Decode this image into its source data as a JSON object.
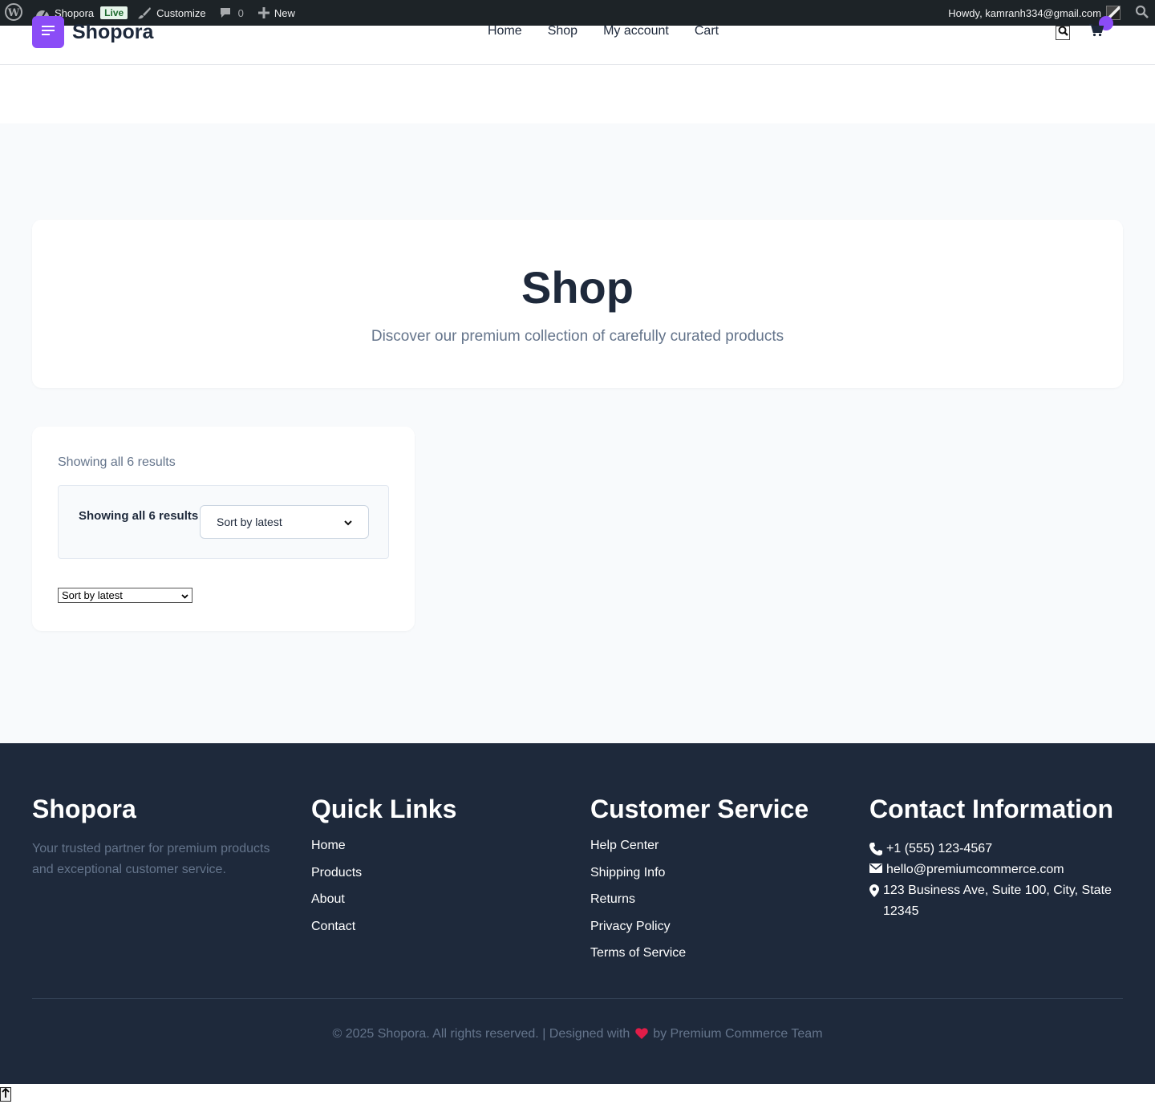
{
  "admin_bar": {
    "site_name": "Shopora",
    "live_badge": "Live",
    "customize": "Customize",
    "comments_count": "0",
    "new_label": "New",
    "howdy": "Howdy, kamranh334@gmail.com"
  },
  "header": {
    "logo_text": "Shopora",
    "nav": [
      "Home",
      "Shop",
      "My account",
      "Cart"
    ],
    "accent_color": "#8b4cf7"
  },
  "hero": {
    "title": "Shop",
    "subtitle": "Discover our premium collection of carefully curated products"
  },
  "shop_panel": {
    "result_count": "Showing all 6 results",
    "inner_result_count": "Showing all 6 results",
    "sort_selected": "Sort by latest",
    "plain_sort_selected": "Sort by latest"
  },
  "footer": {
    "brand": "Shopora",
    "tagline": "Your trusted partner for premium products and exceptional customer service.",
    "quick_links_title": "Quick Links",
    "quick_links": [
      "Home",
      "Products",
      "About",
      "Contact"
    ],
    "customer_service_title": "Customer Service",
    "customer_service": [
      "Help Center",
      "Shipping Info",
      "Returns",
      "Privacy Policy",
      "Terms of Service"
    ],
    "contact_title": "Contact Information",
    "phone": "+1 (555) 123-4567",
    "email": "hello@premiumcommerce.com",
    "address": "123 Business Ave, Suite 100, City, State 12345",
    "copyright_left": "© 2025 Shopora. All rights reserved. | Designed with",
    "copyright_right": "by Premium Commerce Team",
    "background_color": "#1e293b"
  }
}
